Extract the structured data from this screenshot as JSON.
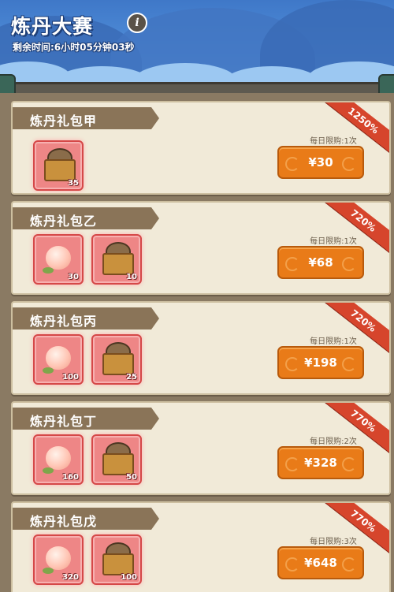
{
  "header": {
    "title": "炼丹大赛",
    "info_icon": "i",
    "timer": "剩余时间:6小时05分钟03秒"
  },
  "packs": [
    {
      "name": "炼丹礼包甲",
      "discount": "1250%",
      "limit": "每日限购:1次",
      "price": "¥30",
      "items": [
        {
          "icon": "chest-icon",
          "count": "35"
        }
      ]
    },
    {
      "name": "炼丹礼包乙",
      "discount": "720%",
      "limit": "每日限购:1次",
      "price": "¥68",
      "items": [
        {
          "icon": "peach-icon",
          "count": "30"
        },
        {
          "icon": "chest-icon",
          "count": "10"
        }
      ]
    },
    {
      "name": "炼丹礼包丙",
      "discount": "720%",
      "limit": "每日限购:1次",
      "price": "¥198",
      "items": [
        {
          "icon": "peach-icon",
          "count": "100"
        },
        {
          "icon": "chest-icon",
          "count": "25"
        }
      ]
    },
    {
      "name": "炼丹礼包丁",
      "discount": "770%",
      "limit": "每日限购:2次",
      "price": "¥328",
      "items": [
        {
          "icon": "peach-icon",
          "count": "160"
        },
        {
          "icon": "chest-icon",
          "count": "50"
        }
      ]
    },
    {
      "name": "炼丹礼包戊",
      "discount": "770%",
      "limit": "每日限购:3次",
      "price": "¥648",
      "items": [
        {
          "icon": "peach-icon",
          "count": "320"
        },
        {
          "icon": "chest-icon",
          "count": "100"
        }
      ]
    }
  ]
}
